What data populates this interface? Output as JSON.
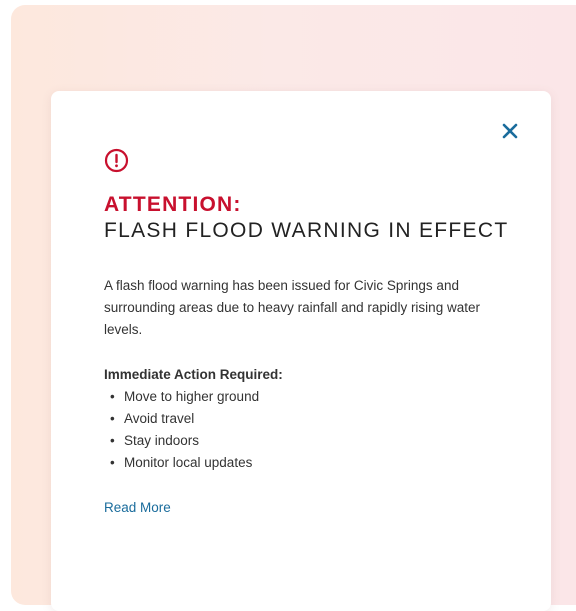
{
  "colors": {
    "accent_red": "#c8102e",
    "link_blue": "#1a6c9c",
    "close_blue": "#1a6c9c",
    "text": "#333333"
  },
  "alert": {
    "icon": "alert-circle-icon",
    "title": "ATTENTION:",
    "headline": "FLASH FLOOD WARNING IN EFFECT",
    "body": "A flash flood warning has been issued for Civic Springs and surrounding areas due to heavy rainfall and rapidly rising water levels.",
    "actions_heading": "Immediate Action Required:",
    "actions": [
      "Move to higher ground",
      "Avoid travel",
      "Stay indoors",
      "Monitor local updates"
    ],
    "read_more_label": "Read More",
    "close_icon": "close-icon"
  }
}
